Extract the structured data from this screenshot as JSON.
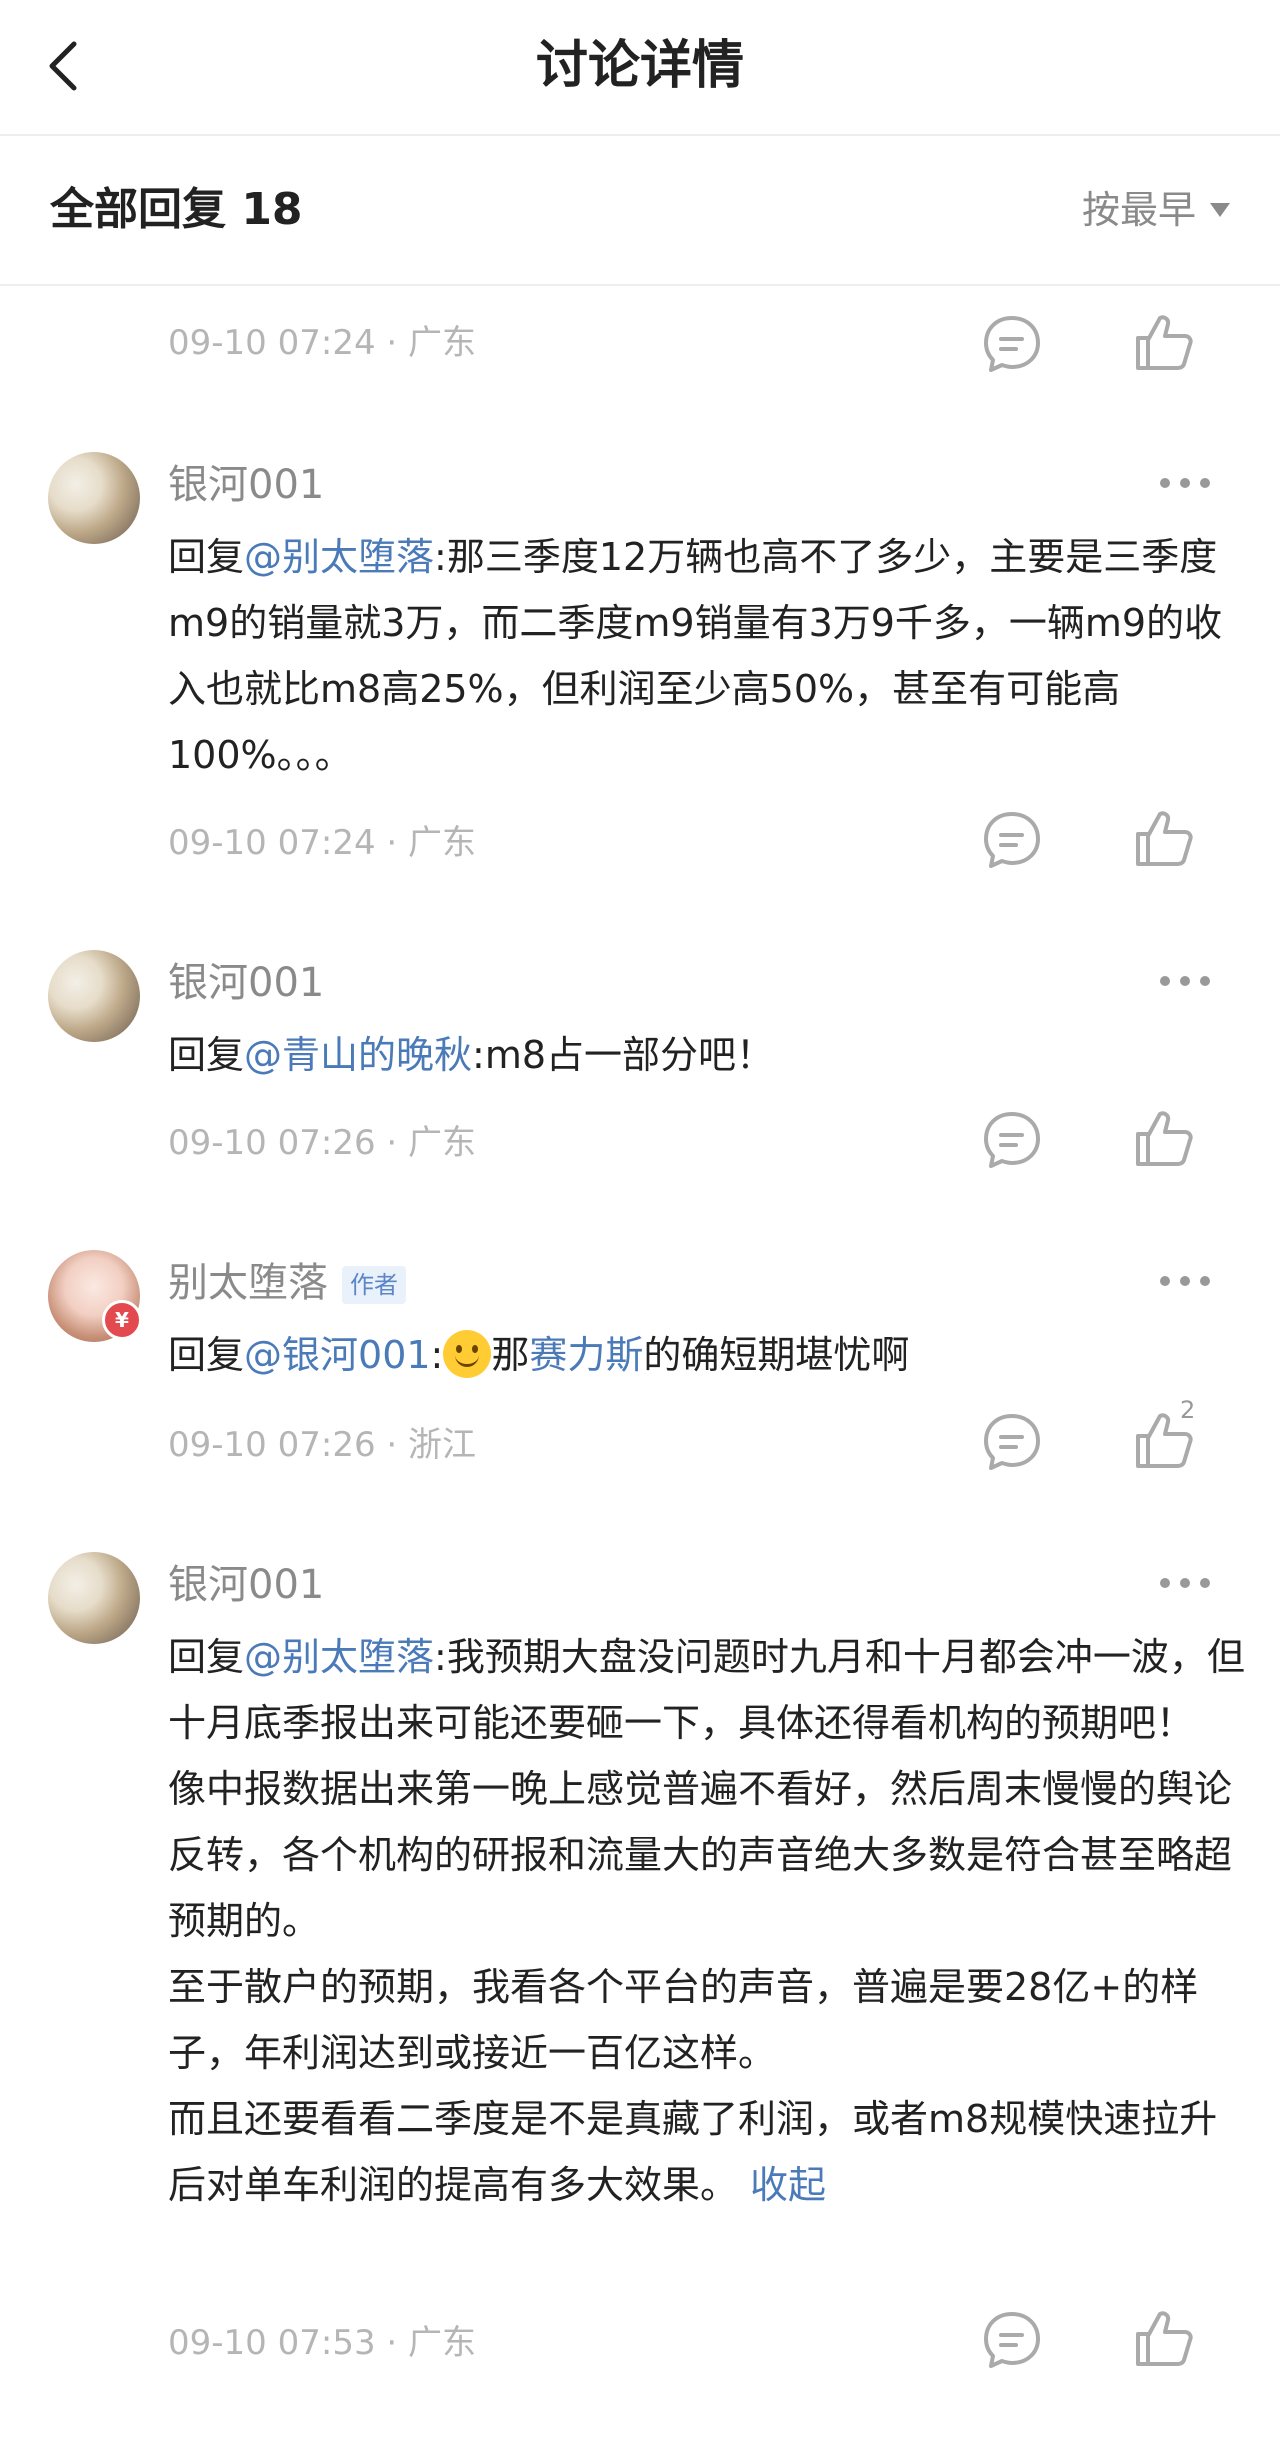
{
  "nav": {
    "title": "讨论详情",
    "back_icon": "chevron-left-icon"
  },
  "header": {
    "reply_count": "全部回复 18",
    "sort": "按最早"
  },
  "colors": {
    "link": "#4a7ab8",
    "meta": "#b5b5b5",
    "name": "#8a8a8a",
    "badge": "#e24a4f"
  },
  "comments": [
    {
      "meta": "09-10 07:24 · 广东"
    },
    {
      "name": "银河001",
      "reply_prefix": "回复",
      "mention": "@别太堕落",
      "text": ":那三季度12万辆也高不了多少，主要是三季度m9的销量就3万，而二季度m9销量有3万9千多，一辆m9的收入也就比m8高25%，但利润至少高50%，甚至有可能高100%。。。",
      "meta": "09-10 07:24 · 广东"
    },
    {
      "name": "银河001",
      "reply_prefix": "回复",
      "mention": "@青山的晚秋",
      "text": ":m8占一部分吧！",
      "meta": "09-10 07:26 · 广东"
    },
    {
      "name": "别太堕落",
      "author_tag": "作者",
      "vip_badge": "¥",
      "reply_prefix": "回复",
      "mention": "@银河001",
      "text_a": ":",
      "emoji": "smile-emoji",
      "text_b": "那",
      "link": "赛力斯",
      "text_c": "的确短期堪忧啊",
      "meta": "09-10 07:26 · 浙江",
      "like_count": "2"
    },
    {
      "name": "银河001",
      "reply_prefix": "回复",
      "mention": "@别太堕落",
      "text": ":我预期大盘没问题时九月和十月都会冲一波，但十月底季报出来可能还要砸一下，具体还得看机构的预期吧！",
      "p2": "像中报数据出来第一晚上感觉普遍不看好，然后周末慢慢的舆论反转，各个机构的研报和流量大的声音绝大多数是符合甚至略超预期的。",
      "p3": "至于散户的预期，我看各个平台的声音，普遍是要28亿+的样子，年利润达到或接近一百亿这样。",
      "p4": "而且还要看看二季度是不是真藏了利润，或者m8规模快速拉升后对单车利润的提高有多大效果。",
      "collapse": "收起",
      "meta": "09-10 07:53 · 广东"
    }
  ]
}
